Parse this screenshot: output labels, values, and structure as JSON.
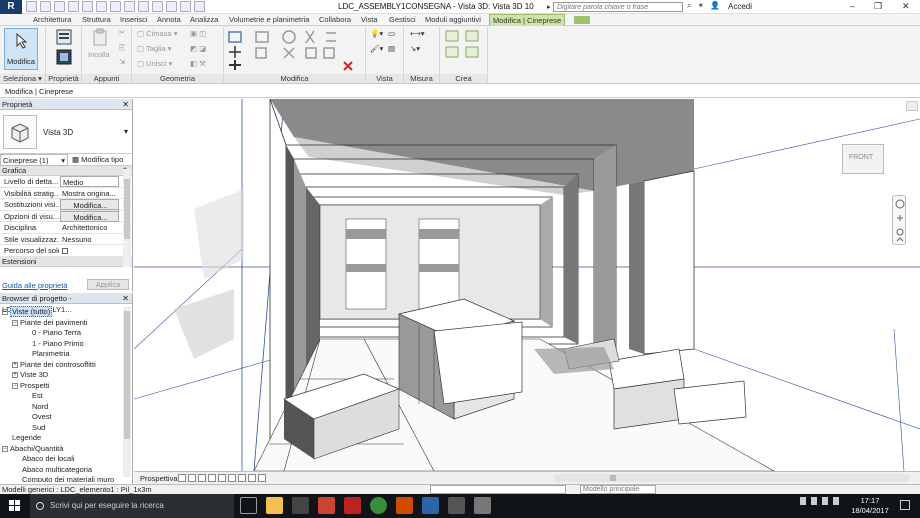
{
  "app": {
    "logo_letter": "R",
    "title": "LDC_ASSEMBLY1CONSEGNA - Vista 3D: Vista 3D 10",
    "search_placeholder": "Digitare parola chiave o frase",
    "user": "Accedi",
    "win_controls": [
      "–",
      "❐",
      "✕"
    ]
  },
  "tabs": [
    {
      "label": "Architettura",
      "active": false
    },
    {
      "label": "Struttura",
      "active": false
    },
    {
      "label": "Inserisci",
      "active": false
    },
    {
      "label": "Annota",
      "active": false
    },
    {
      "label": "Analizza",
      "active": false
    },
    {
      "label": "Volumetrie e planimetria",
      "active": false
    },
    {
      "label": "Collabora",
      "active": false
    },
    {
      "label": "Vista",
      "active": false
    },
    {
      "label": "Gestisci",
      "active": false
    },
    {
      "label": "Moduli aggiuntivi",
      "active": false
    },
    {
      "label": "Modifica | Cineprese",
      "active": true
    }
  ],
  "ribbon": {
    "modify_btn": "Modifica",
    "panels": {
      "select": "Seleziona ▾",
      "properties": "Proprietà",
      "clipboard": "Appunti",
      "geometry": "Geometria",
      "modify": "Modifica",
      "view": "Vista",
      "measure": "Misura",
      "create": "Crea"
    },
    "clipboard_paste": "Incolla",
    "geometry_items": [
      "Cimasa",
      "Taglia",
      "Unisci"
    ]
  },
  "options_bar": "Modifica | Cineprese",
  "properties": {
    "header": "Proprietà",
    "type_name": "Vista 3D",
    "filter": "Cineprese (1)",
    "edit_type": "Modifica tipo",
    "group_graphics": "Grafica",
    "rows": [
      {
        "key": "Livello di detta...",
        "value": "Medio",
        "style": "boxed"
      },
      {
        "key": "Visibilità stratig...",
        "value": "Mostra origina...",
        "style": "plain"
      },
      {
        "key": "Sostituzioni visi...",
        "value": "Modifica...",
        "style": "btn"
      },
      {
        "key": "Opzioni di visu...",
        "value": "Modifica...",
        "style": "btn"
      },
      {
        "key": "Disciplina",
        "value": "Architettonico",
        "style": "plain"
      },
      {
        "key": "Stile visualizzaz...",
        "value": "Nessuno",
        "style": "plain"
      },
      {
        "key": "Percorso del sole",
        "value": "",
        "style": "check"
      }
    ],
    "group_extents": "Estensioni",
    "help_link": "Guida alle proprietà",
    "apply": "Applica"
  },
  "browser": {
    "header": "Browser di progetto - LDC_ASSEMBLY1...",
    "nodes": [
      {
        "label": "Viste (tutto)",
        "level": 0,
        "pm": "−",
        "selected": true
      },
      {
        "label": "Piante dei pavimenti",
        "level": 1,
        "pm": "−"
      },
      {
        "label": "0 - Piano Terra",
        "level": 2,
        "pm": ""
      },
      {
        "label": "1 - Piano Primo",
        "level": 2,
        "pm": ""
      },
      {
        "label": "Planimetria",
        "level": 2,
        "pm": ""
      },
      {
        "label": "Piante dei controsoffitti",
        "level": 1,
        "pm": "+"
      },
      {
        "label": "Viste 3D",
        "level": 1,
        "pm": "+"
      },
      {
        "label": "Prospetti",
        "level": 1,
        "pm": "−"
      },
      {
        "label": "Est",
        "level": 2,
        "pm": ""
      },
      {
        "label": "Nord",
        "level": 2,
        "pm": ""
      },
      {
        "label": "Ovest",
        "level": 2,
        "pm": ""
      },
      {
        "label": "Sud",
        "level": 2,
        "pm": ""
      },
      {
        "label": "Legende",
        "level": 0,
        "pm": ""
      },
      {
        "label": "Abachi/Quantità",
        "level": 0,
        "pm": "−"
      },
      {
        "label": "Abaco dei locali",
        "level": 1,
        "pm": ""
      },
      {
        "label": "Abaco multicategoria",
        "level": 1,
        "pm": ""
      },
      {
        "label": "Computo dei materiali muro",
        "level": 1,
        "pm": ""
      }
    ]
  },
  "viewcube_label": "FRONT",
  "view_bar": {
    "label": "Prospettiva"
  },
  "status": {
    "text": "Modelli generici : LDC_elemento1 : Pil_1x3m",
    "model": "Modello principale"
  },
  "taskbar": {
    "search": "Scrivi qui per eseguire la ricerca",
    "time": "17:17",
    "date": "18/04/2017"
  }
}
